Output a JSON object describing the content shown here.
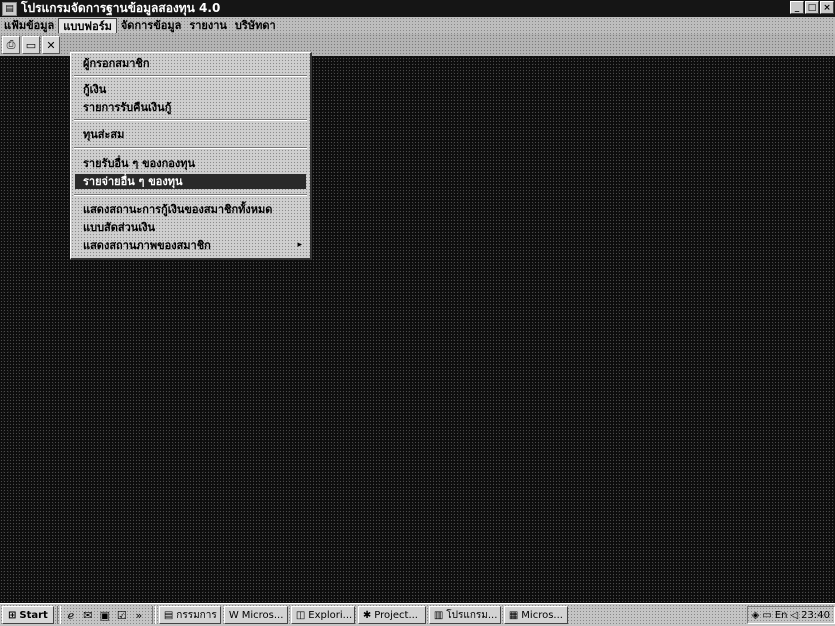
{
  "window": {
    "title": "โปรแกรมจัดการฐานข้อมูลสองทุน 4.0",
    "controls": {
      "minimize": "_",
      "maximize": "□",
      "close": "×"
    }
  },
  "menubar": [
    {
      "label": "แฟ้มข้อมูล"
    },
    {
      "label": "แบบฟอร์ม"
    },
    {
      "label": "จัดการข้อมูล"
    },
    {
      "label": "รายงาน"
    },
    {
      "label": "บริษัทดา"
    }
  ],
  "toolbar": {
    "icons": [
      "printer-icon",
      "document-icon",
      "tools-icon"
    ]
  },
  "dropdown": {
    "items": [
      {
        "label": "ผู้กรอกสมาชิก",
        "highlight": false
      },
      {
        "label": "กู้เงิน",
        "highlight": false
      },
      {
        "label": "รายการรับคืนเงินกู้",
        "highlight": false
      },
      {
        "label": "ทุนส่ะสม",
        "highlight": false
      },
      {
        "label": "รายรับอื่น ๆ ของกองทุน",
        "highlight": false
      },
      {
        "label": "รายจ่ายอื่น ๆ ของทุน",
        "highlight": true
      },
      {
        "label": "แสดงสถานะการกู้เงินของสมาชิกทั้งหมด",
        "highlight": false
      },
      {
        "label": "แบบสัดส่วนเงิน",
        "highlight": false
      },
      {
        "label": "แสดงสถานภาพของสมาชิก",
        "highlight": false,
        "submenu": "▸"
      }
    ]
  },
  "taskbar": {
    "start": "Start",
    "quicklaunch": [
      "ie-icon",
      "outlook-icon",
      "desktop-icon",
      "channel-icon"
    ],
    "chevron": "»",
    "tasks": [
      {
        "label": "กรรมการ"
      },
      {
        "label": "Micros..."
      },
      {
        "label": "Explori..."
      },
      {
        "label": "Project..."
      },
      {
        "label": "โปรแกรม..."
      },
      {
        "label": "Micros..."
      }
    ],
    "tray": {
      "lang": "En",
      "clock": "23:40"
    }
  }
}
